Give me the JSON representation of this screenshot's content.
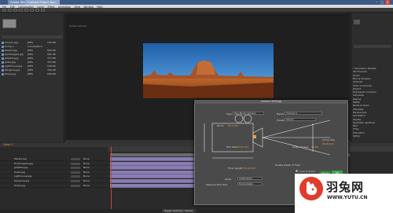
{
  "window": {
    "tab1": "Adobe After Effects",
    "tab2": "Untitled Project.aep"
  },
  "menu": [
    "File",
    "Edit",
    "Composition",
    "Layer",
    "Effect",
    "Animation",
    "View",
    "Window",
    "Help"
  ],
  "project": {
    "rows": [
      {
        "name": "Canyon.jpg",
        "type": "JPEG",
        "size": "150 KB"
      },
      {
        "name": "Comp 1",
        "type": "Composition",
        "size": ""
      },
      {
        "name": "Desert.jpg",
        "type": "JPEG",
        "size": "826 KB"
      },
      {
        "name": "Hydrangeas.jpg",
        "type": "JPEG",
        "size": "581 KB"
      },
      {
        "name": "Jellyfish.jpg",
        "type": "JPEG",
        "size": "757 KB"
      },
      {
        "name": "Koala.jpg",
        "type": "JPEG",
        "size": "763 KB"
      },
      {
        "name": "Lighthouse.jpg",
        "type": "JPEG",
        "size": "548 KB"
      },
      {
        "name": "Penguins.jpg",
        "type": "JPEG",
        "size": "760 KB"
      },
      {
        "name": "Tulips.jpg",
        "type": "JPEG",
        "size": "606 KB"
      }
    ]
  },
  "viewer": {
    "label": "Active Camera"
  },
  "effects": {
    "items": [
      "* Animation Presets",
      "3D Channel",
      "Audio",
      "Blur & Sharpen",
      "Channel",
      "Color Correction",
      "Distort",
      "Expression Controls",
      "Generate",
      "Keying",
      "Matte",
      "Noise & Grain",
      "Obsolete",
      "Perspective",
      "Simulation",
      "Stylize",
      "Synthetic Aperture",
      "Text",
      "Time",
      "Transition",
      "Utility"
    ]
  },
  "timeline": {
    "title": "Comp 1",
    "layers": [
      "Desert.jpg",
      "Hydrangeas.jpg",
      "Jellyfish.jpg",
      "Koala.jpg",
      "Lighthouse.jpg",
      "Penguins.jpg",
      "Tulips.jpg"
    ],
    "mode": "None",
    "footer_tab": "Toggle Switches / Modes"
  },
  "dialog": {
    "title": "Camera Settings",
    "type_label": "Type:",
    "type_value": "Two-Node Camera",
    "name_label": "Name:",
    "name_value": "Camera 1",
    "preset_label": "Preset:",
    "preset_value": "50mm",
    "zoom_label": "Zoom",
    "zoom_value": "50.0 mm",
    "film_size_label": "Film Size",
    "film_size_value": "36.00 mm",
    "angle_label": "Angle of View",
    "angle_value": "39.60",
    "comp_size_label": "Comp Size",
    "comp_size_value": "36.00 mm",
    "focal_label": "Focal Length",
    "focal_value": "50.00 mm",
    "dof_label": "Enable Depth of Field",
    "lock_label": "Lock to Zoom",
    "units_label": "Units:",
    "units_value": "millimeters",
    "measure_label": "Measure Film Size:",
    "measure_value": "Horizontally",
    "ok_label": "OK",
    "cancel_label": "Cancel"
  },
  "watermark": {
    "brand": "羽兔网",
    "url": "WWW.YUTU.CN"
  },
  "colors": {
    "accent_orange": "#f0a530",
    "layer_bar": "#8a7db0",
    "brand_red": "#e23a2b"
  }
}
